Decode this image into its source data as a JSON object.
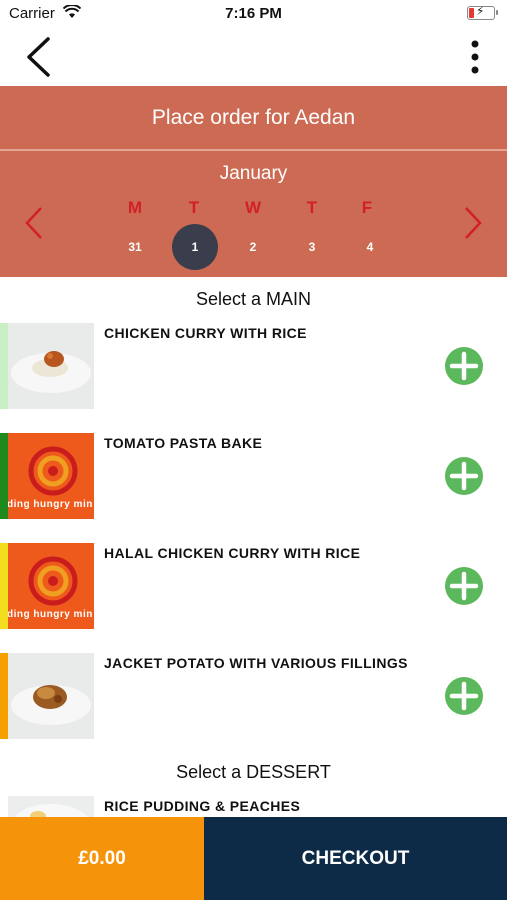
{
  "status_bar": {
    "carrier": "Carrier",
    "time": "7:16 PM"
  },
  "header": {
    "title": "Place order for Aedan"
  },
  "calendar": {
    "month": "January",
    "weekdays": [
      "M",
      "T",
      "W",
      "T",
      "F"
    ],
    "dates": [
      "31",
      "1",
      "2",
      "3",
      "4"
    ],
    "selected_date": "1"
  },
  "sections": [
    {
      "heading": "Select a MAIN",
      "items": [
        {
          "name": "CHICKEN CURRY WITH RICE",
          "bar_color": "#c8efc3",
          "image": "food-photo"
        },
        {
          "name": "TOMATO PASTA BAKE",
          "bar_color": "#1e8a1e",
          "image": "placeholder-logo"
        },
        {
          "name": "HALAL CHICKEN CURRY WITH RICE",
          "bar_color": "#f2dd1f",
          "image": "placeholder-logo"
        },
        {
          "name": "JACKET POTATO WITH VARIOUS FILLINGS",
          "bar_color": "#f5a000",
          "image": "food-photo"
        }
      ]
    },
    {
      "heading": "Select a DESSERT",
      "items": [
        {
          "name": "RICE PUDDING & PEACHES",
          "bar_color": "#ffffff",
          "image": "food-photo"
        }
      ]
    }
  ],
  "placeholder_text": "ding hungry min",
  "footer": {
    "total": "£0.00",
    "checkout_label": "CHECKOUT"
  },
  "colors": {
    "header_bg": "#cd6a53",
    "weekday_red": "#d21f2a",
    "selected_date_bg": "#3a3d4c",
    "add_green": "#5cb85c",
    "total_orange": "#f5940a",
    "checkout_navy": "#0d2a47"
  }
}
